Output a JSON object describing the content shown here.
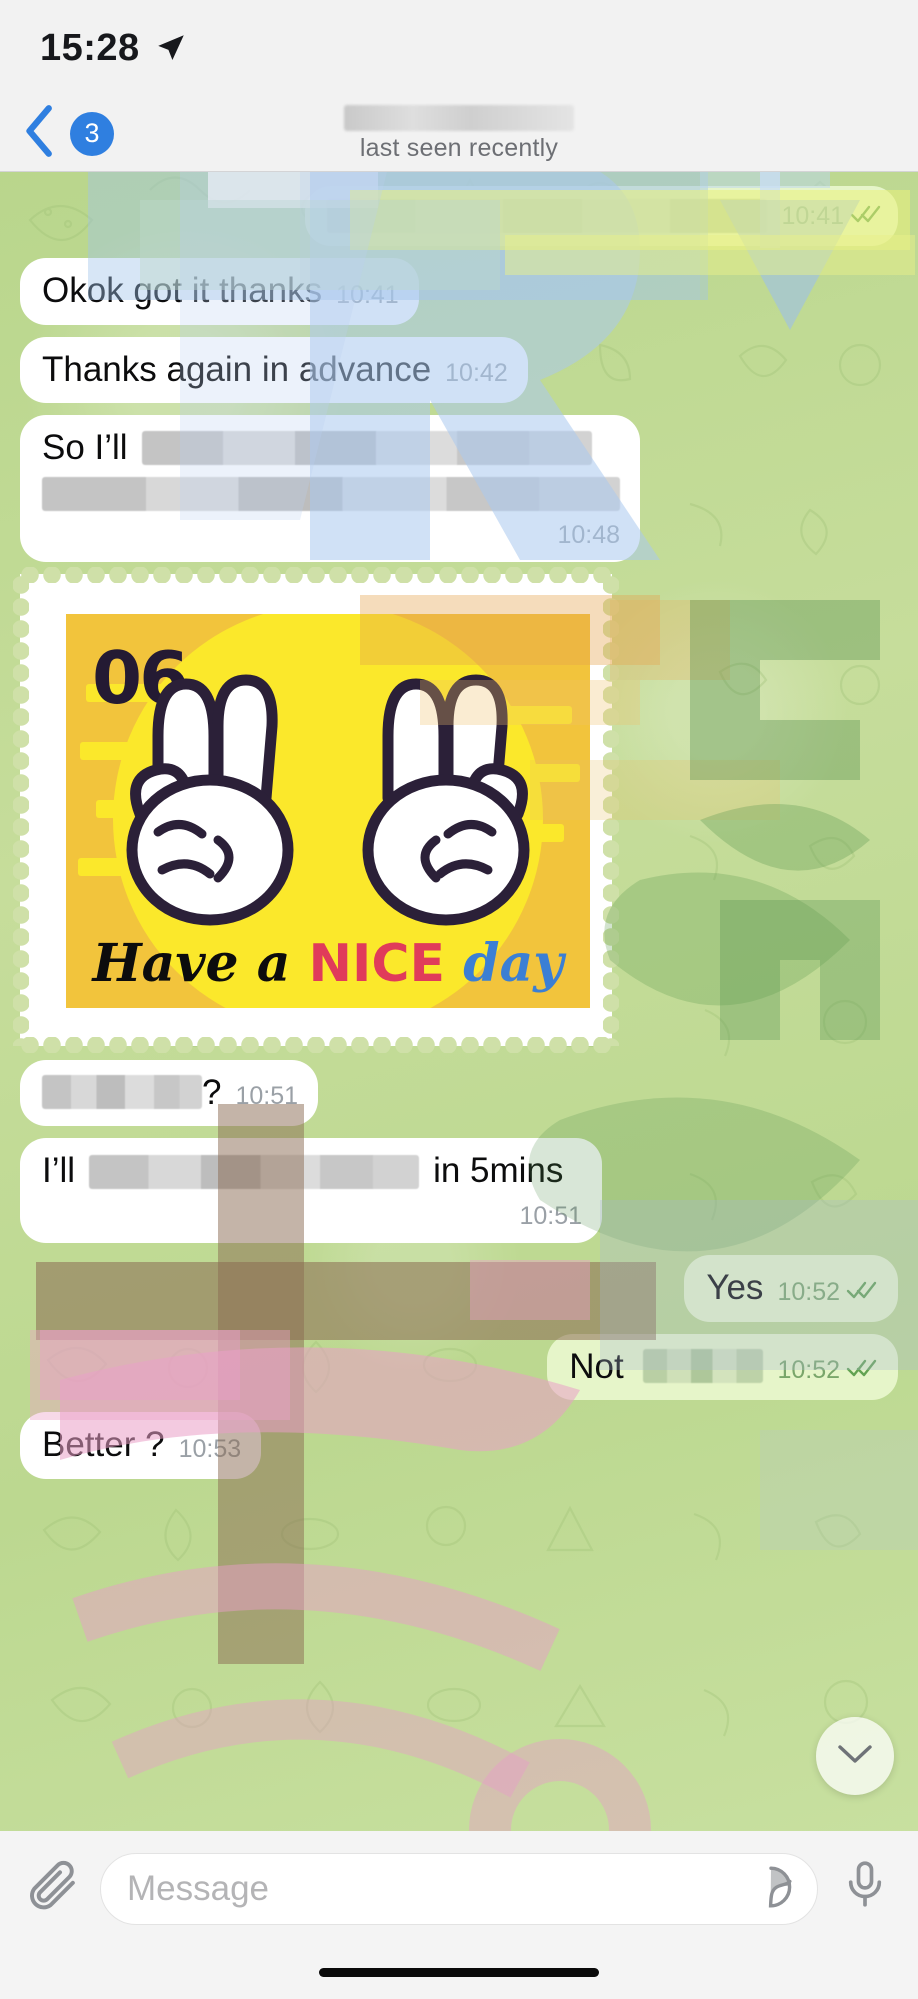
{
  "status_bar": {
    "time": "15:28",
    "location_icon": "location-arrow-icon"
  },
  "chat_header": {
    "back_icon": "chevron-left-icon",
    "unread_badge": "3",
    "contact_name_redacted": "",
    "status": "last seen recently"
  },
  "messages": [
    {
      "id": "msg-1",
      "direction": "out",
      "text": "",
      "redacted": true,
      "time": "10:41",
      "ticks": "double-check-icon"
    },
    {
      "id": "msg-2",
      "direction": "in",
      "text": "Okok got it thanks",
      "redacted": false,
      "time": "10:41",
      "ticks": ""
    },
    {
      "id": "msg-3",
      "direction": "in",
      "text": "Thanks again in advance",
      "redacted": false,
      "time": "10:42",
      "ticks": ""
    },
    {
      "id": "msg-4",
      "direction": "in",
      "text": "So I’ll",
      "redacted": true,
      "time": "10:48",
      "ticks": ""
    },
    {
      "id": "msg-5",
      "direction": "in",
      "type": "sticker",
      "sticker": {
        "name": "have-a-nice-day-stamp-sticker",
        "number": "06",
        "caption_part1": "Have a",
        "caption_part2": "NICE",
        "caption_part3": "day",
        "bg_color": "#f2c43c",
        "sun_color": "#fbe82b",
        "nice_color": "#e03b5a",
        "day_color": "#3b7fd4"
      }
    },
    {
      "id": "msg-6",
      "direction": "in",
      "text": "?",
      "redacted": true,
      "time": "10:51",
      "ticks": ""
    },
    {
      "id": "msg-7",
      "direction": "in",
      "text_before": "I’ll",
      "text_after": "in 5mins",
      "redacted": true,
      "time": "10:51",
      "ticks": ""
    },
    {
      "id": "msg-8",
      "direction": "out",
      "text": "Yes",
      "redacted": false,
      "time": "10:52",
      "ticks": "double-check-icon"
    },
    {
      "id": "msg-9",
      "direction": "out",
      "text": "Not",
      "redacted": true,
      "time": "10:52",
      "ticks": "double-check-icon"
    },
    {
      "id": "msg-10",
      "direction": "in",
      "text": "Better ?",
      "redacted": false,
      "time": "10:53",
      "ticks": ""
    }
  ],
  "scroll_button": {
    "icon": "chevron-down-icon"
  },
  "input_bar": {
    "attach_icon": "paperclip-icon",
    "placeholder": "Message",
    "sticker_icon": "sticker-icon",
    "mic_icon": "microphone-icon"
  },
  "colors": {
    "incoming_bubble": "#ffffff",
    "outgoing_bubble": "#e6f5c9",
    "accent_blue": "#2f7fe0",
    "wallpaper": "#bcd890",
    "timestamp": "#9aa0a6",
    "timestamp_out": "#7aa66a"
  }
}
